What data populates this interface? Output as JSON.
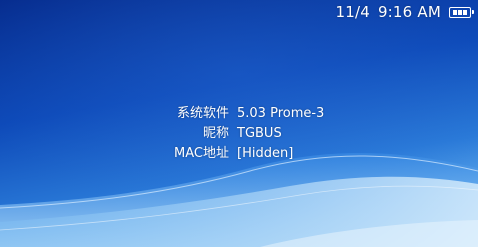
{
  "status": {
    "date": "11/4",
    "time": "9:16 AM",
    "battery_icon": "battery-full-icon",
    "battery_level": 1.0
  },
  "system_info": {
    "rows": [
      {
        "label": "系统软件",
        "value": "5.03 Prome-3"
      },
      {
        "label": "昵称",
        "value": "TGBUS"
      },
      {
        "label": "MAC地址",
        "value": "[Hidden]"
      }
    ]
  },
  "colors": {
    "background_top": "#0a2f8f",
    "background_mid": "#1a5fd0",
    "background_bottom": "#8ec4f0",
    "text": "#ffffff"
  }
}
